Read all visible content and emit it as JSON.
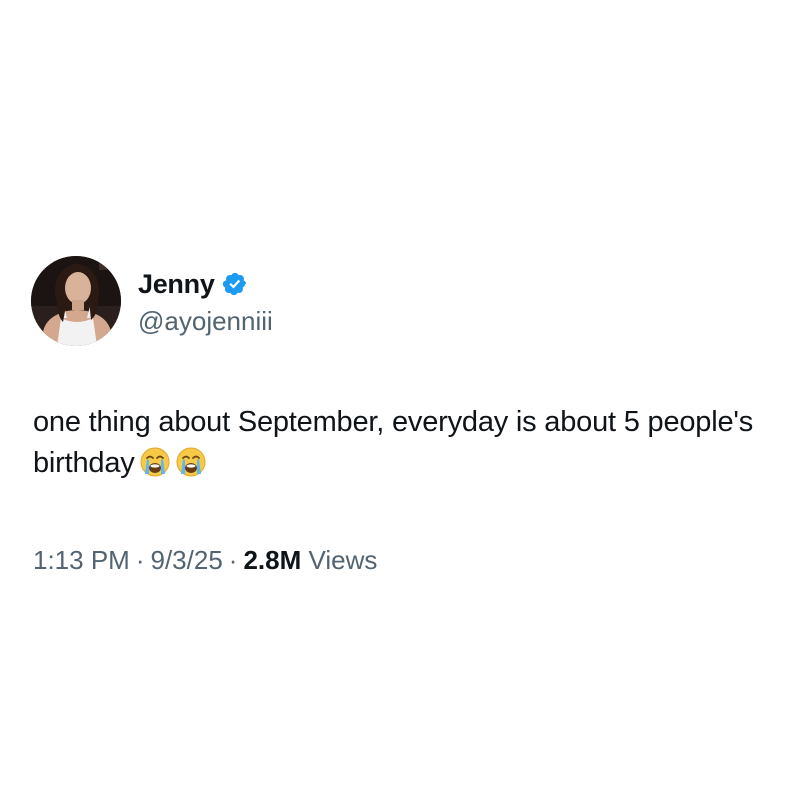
{
  "author": {
    "display_name": "Jenny",
    "handle": "@ayojenniii",
    "verified": true,
    "badge_icon": "verified-badge-icon",
    "badge_color": "#1d9bf0"
  },
  "tweet": {
    "text": "one thing about September, everyday is about 5 people's birthday",
    "emojis": [
      "loudly-crying-face-icon",
      "loudly-crying-face-icon"
    ]
  },
  "meta": {
    "time": "1:13 PM",
    "date": "9/3/25",
    "separator": "·",
    "views_count": "2.8M",
    "views_label": "Views"
  },
  "colors": {
    "text_primary": "#0f1419",
    "text_secondary": "#536471",
    "accent": "#1d9bf0",
    "background": "#ffffff"
  }
}
